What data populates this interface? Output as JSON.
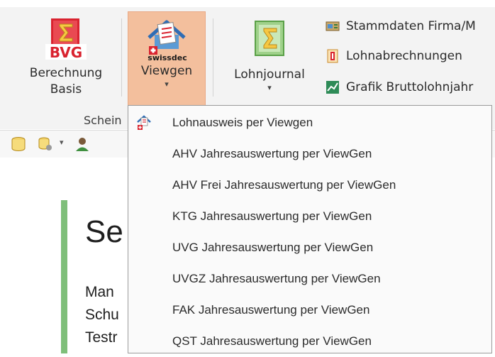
{
  "ribbon": {
    "bvg": {
      "label_line1": "Berechnung",
      "label_line2": "Basis",
      "icon_text": "BVG"
    },
    "viewgen": {
      "label": "Viewgen",
      "icon_text": "swissdec",
      "caret": "▾"
    },
    "lohnjournal": {
      "label": "Lohnjournal",
      "caret": "▾"
    },
    "small_buttons": [
      {
        "label": "Stammdaten Firma/M",
        "icon": "company-data-icon"
      },
      {
        "label": "Lohnabrechnungen",
        "icon": "payslips-icon"
      },
      {
        "label": "Grafik Bruttolohnjahr",
        "icon": "chart-icon"
      }
    ],
    "group_label": "Schein"
  },
  "toolbar": {
    "icons": [
      "database-icon",
      "database-settings-icon",
      "dropdown-caret-icon",
      "user-icon"
    ],
    "caret": "▾"
  },
  "document": {
    "title": "Se",
    "lines": [
      "Man",
      "Schu",
      "Testr"
    ]
  },
  "menu": {
    "items": [
      "Lohnausweis per Viewgen",
      "AHV Jahresauswertung per ViewGen",
      "AHV Frei Jahresauswertung per ViewGen",
      "KTG Jahresauswertung per ViewGen",
      "UVG Jahresauswertung per ViewGen",
      "UVGZ Jahresauswertung per ViewGen",
      "FAK Jahresauswertung per ViewGen",
      "QST Jahresauswertung per ViewGen"
    ]
  },
  "colors": {
    "viewgen_active": "#f3bf9d",
    "bvg_red": "#d9232f",
    "doc_accent_green": "#7fbf7a"
  }
}
